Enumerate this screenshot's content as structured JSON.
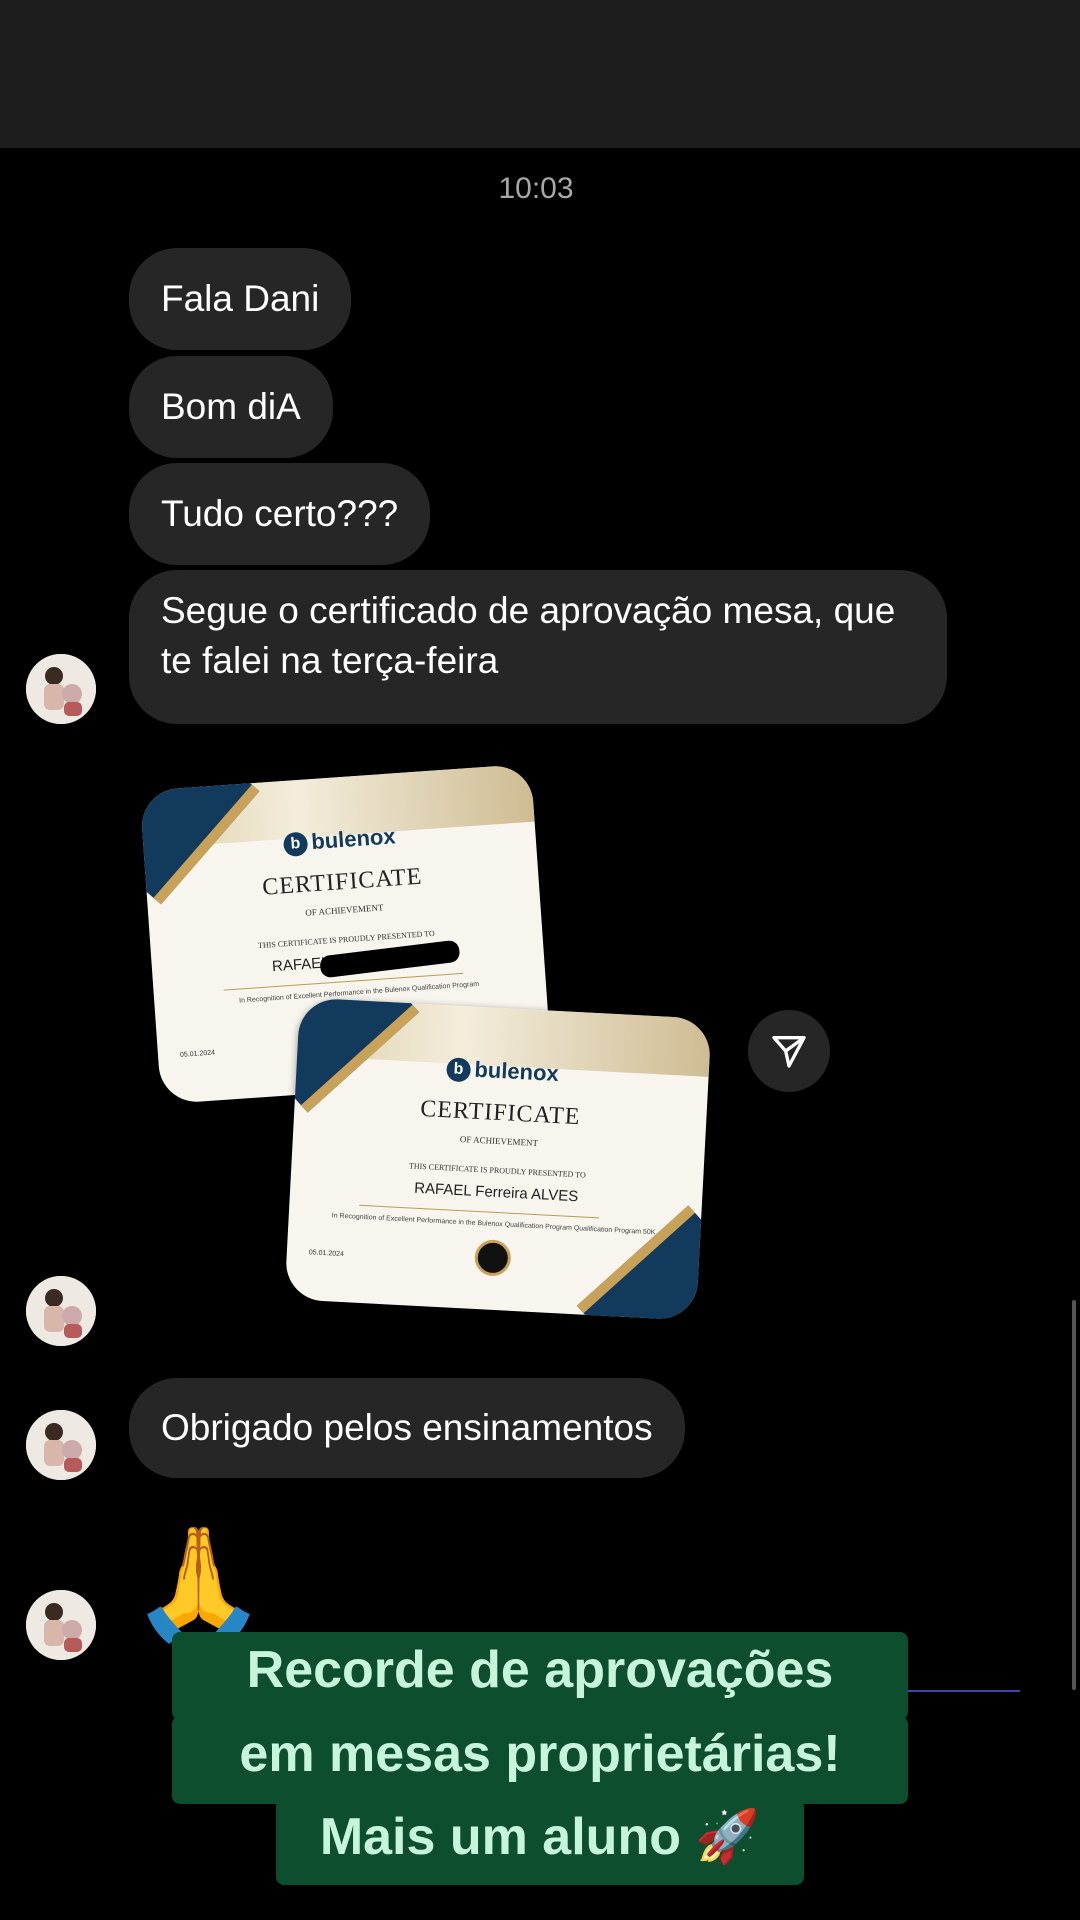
{
  "chat": {
    "timestamp": "10:03",
    "messages": [
      {
        "text": "Fala Dani"
      },
      {
        "text": "Bom diA"
      },
      {
        "text": "Tudo certo???"
      },
      {
        "text": "Segue o certificado de aprovação mesa, que te falei na terça-feira"
      },
      {
        "text": "Obrigado pelos ensinamentos"
      }
    ],
    "emoji_reaction": "🙏"
  },
  "certificates": [
    {
      "brand": "bulenox",
      "title": "CERTIFICATE",
      "subtitle": "OF ACHIEVEMENT",
      "presented": "THIS CERTIFICATE IS PROUDLY PRESENTED TO",
      "name": "RAFAEL",
      "recognition": "In Recognition of Excellent Performance in the Bulenox Qualification Program",
      "date": "05.01.2024"
    },
    {
      "brand": "bulenox",
      "title": "CERTIFICATE",
      "subtitle": "OF ACHIEVEMENT",
      "presented": "THIS CERTIFICATE IS PROUDLY PRESENTED TO",
      "name": "RAFAEL Ferreira ALVES",
      "recognition": "In Recognition of Excellent Performance in the Bulenox Qualification Program Qualification Program 50K",
      "date": "05.01.2024"
    }
  ],
  "overlay": {
    "line1": "Recorde de aprovações",
    "line2": "em mesas proprietárias!",
    "line3": "Mais um aluno 🚀"
  },
  "colors": {
    "bubble": "#262626",
    "banner_bg": "#0c4e2d",
    "banner_text": "#c7f5d9",
    "cert_navy": "#123a5c",
    "cert_gold": "#c9a25a"
  },
  "icons": [
    "share-icon",
    "avatar-icon"
  ]
}
